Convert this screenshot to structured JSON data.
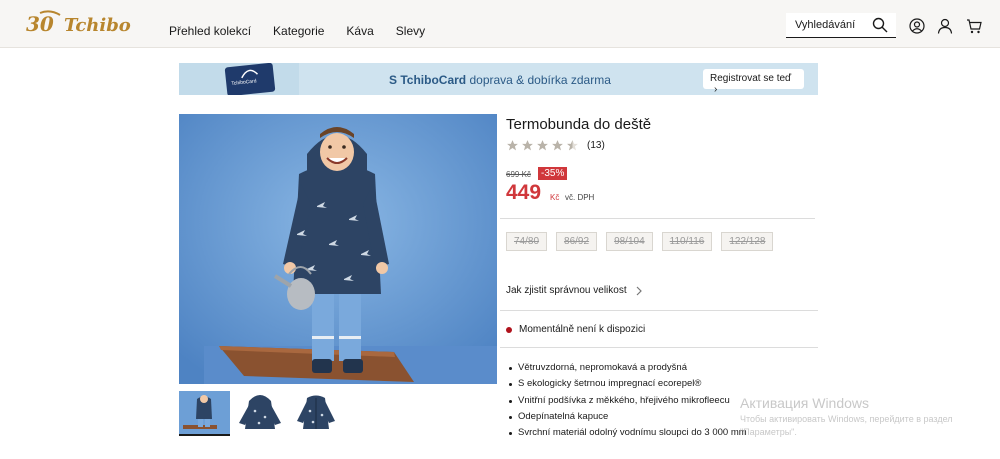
{
  "header": {
    "logo_text": "30 Tchibo",
    "nav": [
      "Přehled kolekcí",
      "Kategorie",
      "Káva",
      "Slevy"
    ],
    "search_placeholder": "Vyhledávání",
    "icons": [
      "search-icon",
      "account-circle-icon",
      "user-icon",
      "cart-icon"
    ]
  },
  "banner": {
    "card_label": "TchiboCard",
    "brand": "S TchiboCard",
    "message": "doprava & dobírka zdarma",
    "register": "Registrovat se teď",
    "register_chevron": "›"
  },
  "product": {
    "title": "Termobunda do deště",
    "rating": 4.5,
    "rating_count": "(13)",
    "old_price": "699 Kč",
    "discount": "-35%",
    "price": "449",
    "currency": "Kč",
    "vat": "vč. DPH",
    "sizes": [
      "74/80",
      "86/92",
      "98/104",
      "110/116",
      "122/128"
    ],
    "size_guide": "Jak zjistit správnou velikost",
    "availability": "Momentálně není k dispozici",
    "features": [
      "Větruvzdorná, nepromokavá a prodyšná",
      "S ekologicky šetrnou impregnací ecorepel®",
      "Vnitřní podšívka z měkkého, hřejivého mikrofleecu",
      "Odepínatelná kapuce",
      "Svrchní materiál odolný vodnímu sloupci do 3 000 mm"
    ]
  },
  "watermark": {
    "title": "Активация Windows",
    "line1": "Чтобы активировать Windows, перейдите в раздел",
    "line2": "\"Параметры\"."
  },
  "colors": {
    "price_red": "#d0373b",
    "banner_blue": "#cfe3ef",
    "brand_gold": "#b8862e",
    "availability_dot": "#b0121c"
  }
}
